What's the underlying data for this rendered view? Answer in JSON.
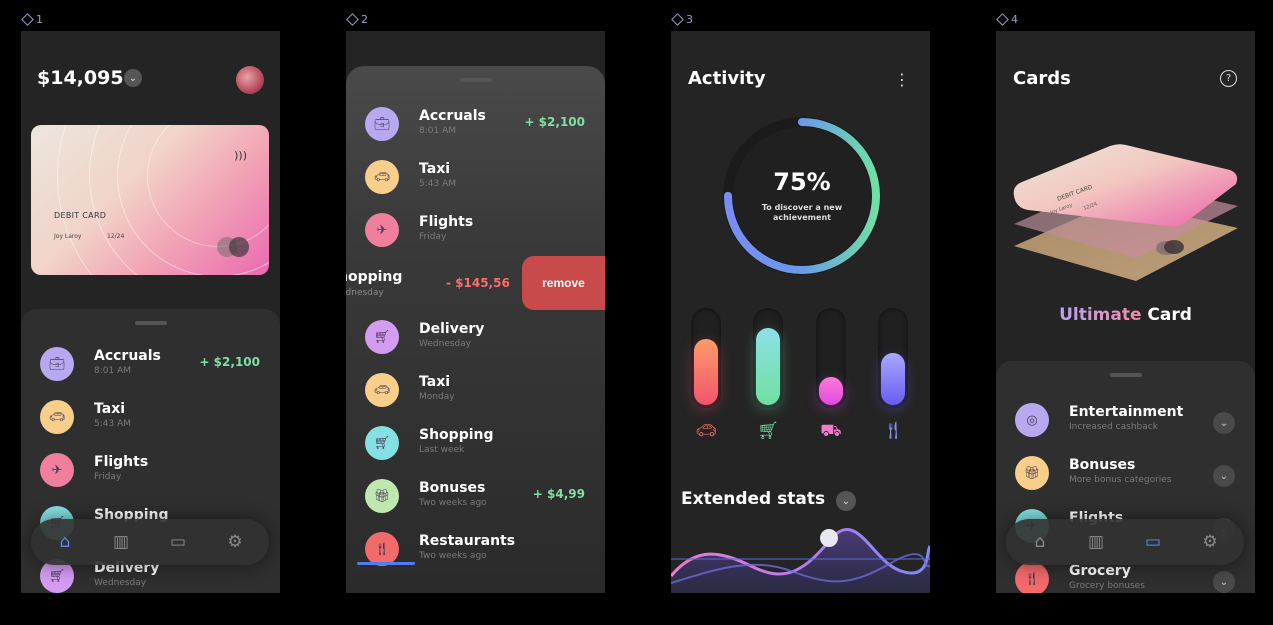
{
  "frames": [
    {
      "number": "1"
    },
    {
      "number": "2"
    },
    {
      "number": "3"
    },
    {
      "number": "4"
    }
  ],
  "screen1": {
    "balance": "$14,095",
    "card": {
      "type": "DEBIT CARD",
      "holder": "Joy Laroy",
      "expiry": "12/24"
    },
    "transactions": [
      {
        "title": "Accruals",
        "subtitle": "8:01 AM",
        "amount": "+ $2,100",
        "icon": "briefcase-icon",
        "color": "#b8a8f0"
      },
      {
        "title": "Taxi",
        "subtitle": "5:43 AM",
        "amount": "",
        "icon": "car-icon",
        "color": "#f7cf8a"
      },
      {
        "title": "Flights",
        "subtitle": "Friday",
        "amount": "",
        "icon": "plane-icon",
        "color": "#f07f9e"
      },
      {
        "title": "Shopping",
        "subtitle": "",
        "amount": "",
        "icon": "cart-icon",
        "color": "#84e0e2"
      },
      {
        "title": "Delivery",
        "subtitle": "Wednesday",
        "amount": "",
        "icon": "cart-icon",
        "color": "#d49cf0"
      }
    ]
  },
  "screen2": {
    "transactions_top": [
      {
        "title": "Accruals",
        "subtitle": "8:01 AM",
        "amount": "+ $2,100",
        "icon": "briefcase-icon",
        "color": "#b8a8f0"
      },
      {
        "title": "Taxi",
        "subtitle": "5:43 AM",
        "amount": "",
        "icon": "car-icon",
        "color": "#f7cf8a"
      },
      {
        "title": "Flights",
        "subtitle": "Friday",
        "amount": "",
        "icon": "plane-icon",
        "color": "#f07f9e"
      }
    ],
    "swiped": {
      "title": "hopping",
      "subtitle": "ednesday",
      "amount": "- $145,56",
      "action": "remove"
    },
    "transactions_bottom": [
      {
        "title": "Delivery",
        "subtitle": "Wednesday",
        "amount": "",
        "icon": "cart-icon",
        "color": "#d49cf0"
      },
      {
        "title": "Taxi",
        "subtitle": "Monday",
        "amount": "",
        "icon": "car-icon",
        "color": "#f7cf8a"
      },
      {
        "title": "Shopping",
        "subtitle": "Last week",
        "amount": "",
        "icon": "cart-icon",
        "color": "#84e0e2"
      },
      {
        "title": "Bonuses",
        "subtitle": "Two weeks ago",
        "amount": "+ $4,99",
        "icon": "gift-icon",
        "color": "#bfe8b0"
      },
      {
        "title": "Restaurants",
        "subtitle": "Two weeks ago",
        "amount": "",
        "icon": "fork-knife-icon",
        "color": "#f26a6a"
      }
    ]
  },
  "screen3": {
    "title": "Activity",
    "progress": {
      "value": "75%",
      "fraction": 0.75,
      "caption": "To discover a new achievement"
    },
    "bars": [
      {
        "category": "car",
        "level": 0.7,
        "color_top": "#ff9a6a",
        "color_bottom": "#f0566a"
      },
      {
        "category": "cart",
        "level": 0.82,
        "color_top": "#8ee0e8",
        "color_bottom": "#6fe0a0"
      },
      {
        "category": "truck",
        "level": 0.3,
        "color_top": "#ff7ad8",
        "color_bottom": "#e04ae0"
      },
      {
        "category": "fork-knife",
        "level": 0.55,
        "color_top": "#a8a8ff",
        "color_bottom": "#6a5cf0"
      }
    ],
    "section": "Extended stats"
  },
  "screen4": {
    "title": "Cards",
    "card_name_accent": "Ultimate",
    "card_name_rest": "Card",
    "card": {
      "type": "DEBIT CARD",
      "holder": "Joy Laroy",
      "expiry": "12/24"
    },
    "benefits": [
      {
        "title": "Entertainment",
        "subtitle": "Increased cashback",
        "icon": "film-reel-icon",
        "color": "#b8a8f0"
      },
      {
        "title": "Bonuses",
        "subtitle": "More bonus categories",
        "icon": "gift-icon",
        "color": "#f7cf8a"
      },
      {
        "title": "Flights",
        "subtitle": "",
        "icon": "plane-icon",
        "color": "#84e0e2"
      },
      {
        "title": "Grocery",
        "subtitle": "Grocery bonuses",
        "icon": "fork-knife-icon",
        "color": "#f26a6a"
      }
    ]
  },
  "nav": {
    "items": [
      "home-icon",
      "stats-icon",
      "card-icon",
      "settings-icon"
    ],
    "active_color": "#5a8af0"
  }
}
